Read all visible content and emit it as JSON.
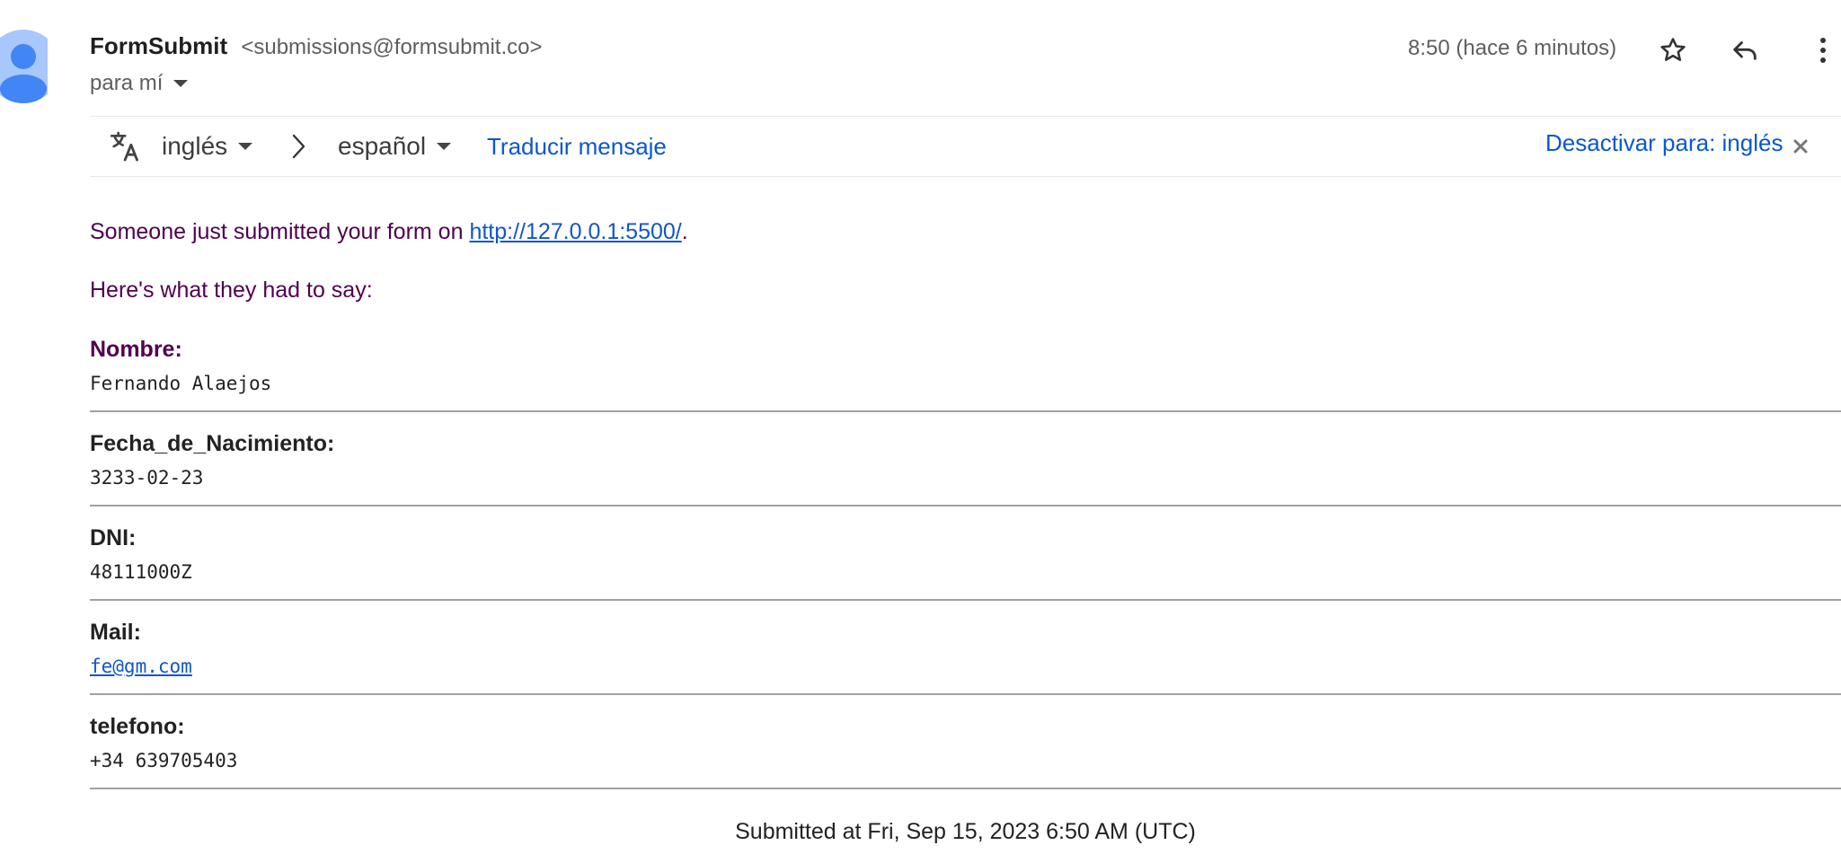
{
  "header": {
    "sender_name": "FormSubmit",
    "sender_email": "<submissions@formsubmit.co>",
    "recipient": "para mí",
    "time": "8:50 (hace 6 minutos)"
  },
  "icons": {
    "avatar": "person-avatar-icon",
    "star": "star-icon",
    "reply": "reply-icon",
    "more": "more-vert-icon",
    "translate": "translate-icon",
    "arrow": "chevron-right-icon",
    "close": "close-icon"
  },
  "translate_bar": {
    "source_lang": "inglés",
    "target_lang": "español",
    "translate_link": "Traducir mensaje",
    "disable_link": "Desactivar para: inglés"
  },
  "message": {
    "intro_prefix": "Someone just submitted your form on ",
    "intro_link": "http://127.0.0.1:5500/",
    "intro_suffix": ".",
    "subtitle": "Here's what they had to say:",
    "fields": [
      {
        "label": "Nombre:",
        "value": "Fernando Alaejos"
      },
      {
        "label": "Fecha_de_Nacimiento:",
        "value": "3233-02-23"
      },
      {
        "label": "DNI:",
        "value": "48111000Z"
      },
      {
        "label": "Mail:",
        "value": "fe@gm.com"
      },
      {
        "label": "telefono:",
        "value": "+34 639705403"
      }
    ],
    "footer": "Submitted at Fri, Sep 15, 2023 6:50 AM (UTC)"
  },
  "colors": {
    "link_blue": "#0b57d0",
    "message_purple": "#500050",
    "avatar_blue": "#4285f4",
    "avatar_bg": "#a8c7fa"
  }
}
